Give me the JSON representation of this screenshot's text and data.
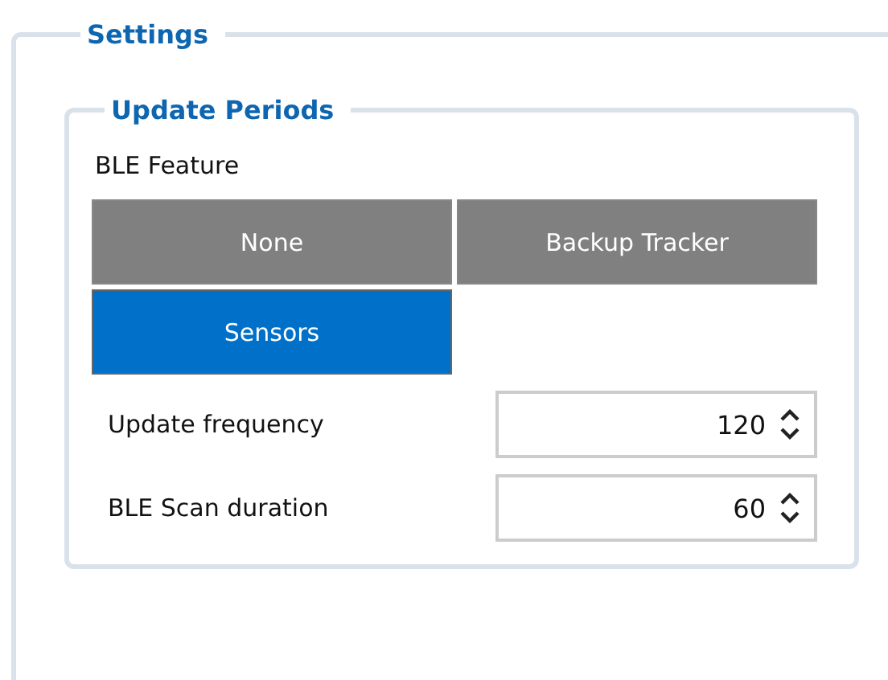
{
  "settings": {
    "title": "Settings",
    "update_periods": {
      "title": "Update Periods",
      "ble_feature": {
        "label": "BLE Feature",
        "options": [
          {
            "label": "None",
            "selected": false
          },
          {
            "label": "Backup Tracker",
            "selected": false
          },
          {
            "label": "Sensors",
            "selected": true
          }
        ]
      },
      "fields": [
        {
          "label": "Update frequency",
          "value": "120"
        },
        {
          "label": "BLE Scan duration",
          "value": "60"
        }
      ]
    }
  }
}
